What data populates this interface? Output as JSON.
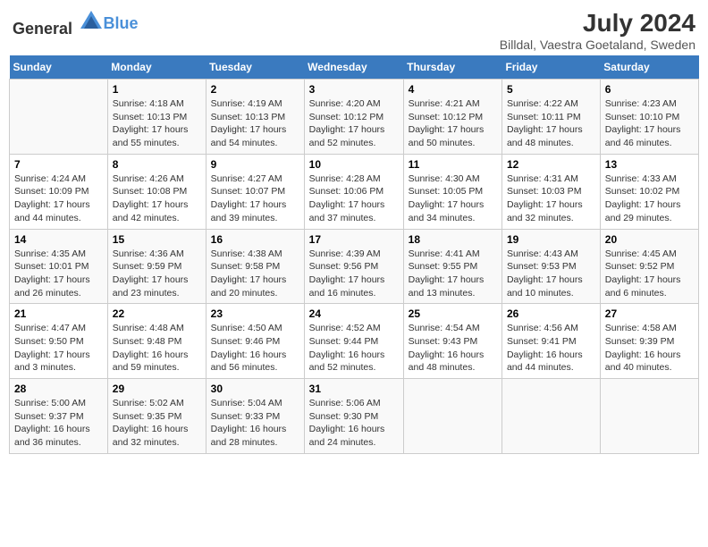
{
  "header": {
    "logo_general": "General",
    "logo_blue": "Blue",
    "title": "July 2024",
    "subtitle": "Billdal, Vaestra Goetaland, Sweden"
  },
  "days_of_week": [
    "Sunday",
    "Monday",
    "Tuesday",
    "Wednesday",
    "Thursday",
    "Friday",
    "Saturday"
  ],
  "weeks": [
    [
      {
        "day": "",
        "info": ""
      },
      {
        "day": "1",
        "info": "Sunrise: 4:18 AM\nSunset: 10:13 PM\nDaylight: 17 hours and 55 minutes."
      },
      {
        "day": "2",
        "info": "Sunrise: 4:19 AM\nSunset: 10:13 PM\nDaylight: 17 hours and 54 minutes."
      },
      {
        "day": "3",
        "info": "Sunrise: 4:20 AM\nSunset: 10:12 PM\nDaylight: 17 hours and 52 minutes."
      },
      {
        "day": "4",
        "info": "Sunrise: 4:21 AM\nSunset: 10:12 PM\nDaylight: 17 hours and 50 minutes."
      },
      {
        "day": "5",
        "info": "Sunrise: 4:22 AM\nSunset: 10:11 PM\nDaylight: 17 hours and 48 minutes."
      },
      {
        "day": "6",
        "info": "Sunrise: 4:23 AM\nSunset: 10:10 PM\nDaylight: 17 hours and 46 minutes."
      }
    ],
    [
      {
        "day": "7",
        "info": "Sunrise: 4:24 AM\nSunset: 10:09 PM\nDaylight: 17 hours and 44 minutes."
      },
      {
        "day": "8",
        "info": "Sunrise: 4:26 AM\nSunset: 10:08 PM\nDaylight: 17 hours and 42 minutes."
      },
      {
        "day": "9",
        "info": "Sunrise: 4:27 AM\nSunset: 10:07 PM\nDaylight: 17 hours and 39 minutes."
      },
      {
        "day": "10",
        "info": "Sunrise: 4:28 AM\nSunset: 10:06 PM\nDaylight: 17 hours and 37 minutes."
      },
      {
        "day": "11",
        "info": "Sunrise: 4:30 AM\nSunset: 10:05 PM\nDaylight: 17 hours and 34 minutes."
      },
      {
        "day": "12",
        "info": "Sunrise: 4:31 AM\nSunset: 10:03 PM\nDaylight: 17 hours and 32 minutes."
      },
      {
        "day": "13",
        "info": "Sunrise: 4:33 AM\nSunset: 10:02 PM\nDaylight: 17 hours and 29 minutes."
      }
    ],
    [
      {
        "day": "14",
        "info": "Sunrise: 4:35 AM\nSunset: 10:01 PM\nDaylight: 17 hours and 26 minutes."
      },
      {
        "day": "15",
        "info": "Sunrise: 4:36 AM\nSunset: 9:59 PM\nDaylight: 17 hours and 23 minutes."
      },
      {
        "day": "16",
        "info": "Sunrise: 4:38 AM\nSunset: 9:58 PM\nDaylight: 17 hours and 20 minutes."
      },
      {
        "day": "17",
        "info": "Sunrise: 4:39 AM\nSunset: 9:56 PM\nDaylight: 17 hours and 16 minutes."
      },
      {
        "day": "18",
        "info": "Sunrise: 4:41 AM\nSunset: 9:55 PM\nDaylight: 17 hours and 13 minutes."
      },
      {
        "day": "19",
        "info": "Sunrise: 4:43 AM\nSunset: 9:53 PM\nDaylight: 17 hours and 10 minutes."
      },
      {
        "day": "20",
        "info": "Sunrise: 4:45 AM\nSunset: 9:52 PM\nDaylight: 17 hours and 6 minutes."
      }
    ],
    [
      {
        "day": "21",
        "info": "Sunrise: 4:47 AM\nSunset: 9:50 PM\nDaylight: 17 hours and 3 minutes."
      },
      {
        "day": "22",
        "info": "Sunrise: 4:48 AM\nSunset: 9:48 PM\nDaylight: 16 hours and 59 minutes."
      },
      {
        "day": "23",
        "info": "Sunrise: 4:50 AM\nSunset: 9:46 PM\nDaylight: 16 hours and 56 minutes."
      },
      {
        "day": "24",
        "info": "Sunrise: 4:52 AM\nSunset: 9:44 PM\nDaylight: 16 hours and 52 minutes."
      },
      {
        "day": "25",
        "info": "Sunrise: 4:54 AM\nSunset: 9:43 PM\nDaylight: 16 hours and 48 minutes."
      },
      {
        "day": "26",
        "info": "Sunrise: 4:56 AM\nSunset: 9:41 PM\nDaylight: 16 hours and 44 minutes."
      },
      {
        "day": "27",
        "info": "Sunrise: 4:58 AM\nSunset: 9:39 PM\nDaylight: 16 hours and 40 minutes."
      }
    ],
    [
      {
        "day": "28",
        "info": "Sunrise: 5:00 AM\nSunset: 9:37 PM\nDaylight: 16 hours and 36 minutes."
      },
      {
        "day": "29",
        "info": "Sunrise: 5:02 AM\nSunset: 9:35 PM\nDaylight: 16 hours and 32 minutes."
      },
      {
        "day": "30",
        "info": "Sunrise: 5:04 AM\nSunset: 9:33 PM\nDaylight: 16 hours and 28 minutes."
      },
      {
        "day": "31",
        "info": "Sunrise: 5:06 AM\nSunset: 9:30 PM\nDaylight: 16 hours and 24 minutes."
      },
      {
        "day": "",
        "info": ""
      },
      {
        "day": "",
        "info": ""
      },
      {
        "day": "",
        "info": ""
      }
    ]
  ]
}
